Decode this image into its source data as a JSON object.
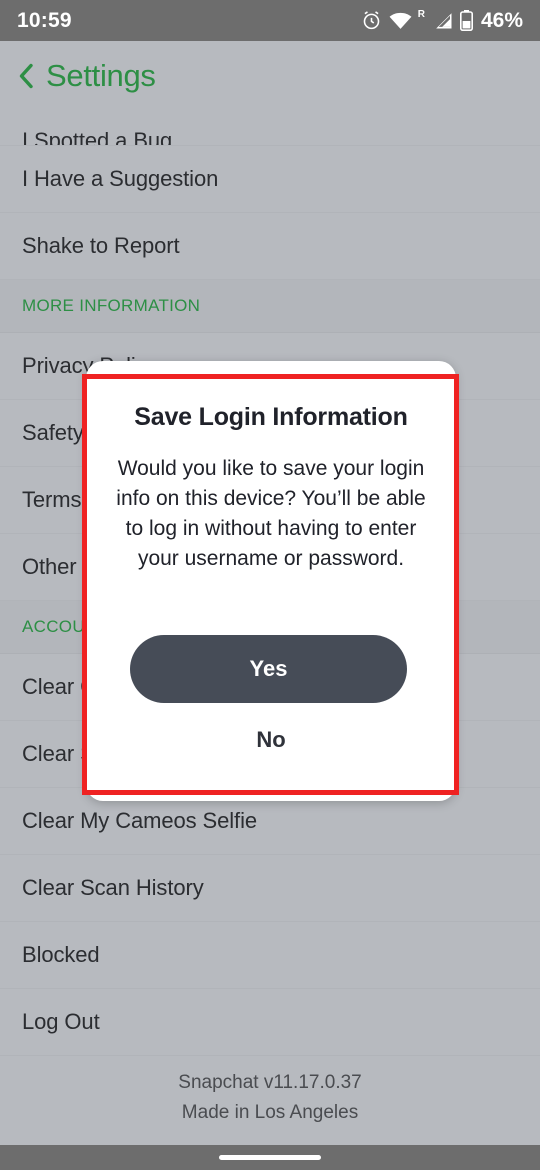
{
  "status_bar": {
    "time": "10:59",
    "battery_percent": "46%",
    "roaming_label": "R",
    "icons": [
      "alarm-icon",
      "wifi-icon",
      "cellular-signal-icon",
      "battery-icon"
    ]
  },
  "header": {
    "title": "Settings",
    "back_icon": "chevron-left-icon"
  },
  "colors": {
    "accent_green": "#2d8f45",
    "page_background": "#b7babf",
    "status_bar": "#6d6d6d",
    "button_dark": "#464c57",
    "highlight_red": "#ef2222"
  },
  "settings_rows": [
    {
      "label": "I Spotted a Bug",
      "type": "item",
      "clipped": true
    },
    {
      "label": "I Have a Suggestion",
      "type": "item"
    },
    {
      "label": "Shake to Report",
      "type": "item"
    },
    {
      "label": "MORE INFORMATION",
      "type": "section"
    },
    {
      "label": "Privacy Policy",
      "type": "item"
    },
    {
      "label": "Safety Center",
      "type": "item"
    },
    {
      "label": "Terms of Service",
      "type": "item"
    },
    {
      "label": "Other Legal Notices",
      "type": "item"
    },
    {
      "label": "ACCOUNT ACTIONS",
      "type": "section"
    },
    {
      "label": "Clear Conversation",
      "type": "item"
    },
    {
      "label": "Clear Search History",
      "type": "item"
    },
    {
      "label": "Clear My Cameos Selfie",
      "type": "item"
    },
    {
      "label": "Clear Scan History",
      "type": "item"
    },
    {
      "label": "Blocked",
      "type": "item"
    },
    {
      "label": "Log Out",
      "type": "item"
    }
  ],
  "footer": {
    "version": "Snapchat v11.17.0.37",
    "made_in": "Made in Los Angeles"
  },
  "dialog": {
    "title": "Save Login Information",
    "body": "Would you like to save your login info on this device? You’ll be able to log in without having to enter your username or password.",
    "primary_button": "Yes",
    "secondary_button": "No"
  },
  "nav_bar": {
    "home_indicator": "home-pill-indicator"
  }
}
